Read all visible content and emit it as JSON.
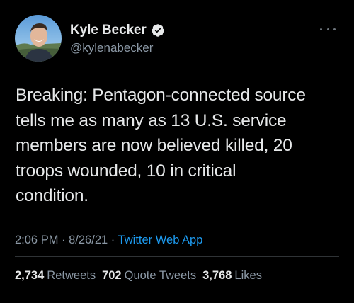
{
  "user": {
    "display_name": "Kyle Becker",
    "handle": "@kylenabecker",
    "verified_icon": "verified-badge-icon",
    "avatar_icon": "profile-photo"
  },
  "tweet": {
    "text": "Breaking: Pentagon-connected source\ntells me as many as 13 U.S. service\nmembers are now believed killed, 20\ntroops wounded, 10 in critical\ncondition."
  },
  "meta": {
    "time": "2:06 PM",
    "separator": " · ",
    "date": "8/26/21",
    "source": "Twitter Web App"
  },
  "stats": {
    "retweets_count": "2,734",
    "retweets_label": "Retweets",
    "quote_tweets_count": "702",
    "quote_tweets_label": "Quote Tweets",
    "likes_count": "3,768",
    "likes_label": "Likes"
  },
  "colors": {
    "background": "#000000",
    "text_primary": "#e7e9ea",
    "text_secondary": "#8b98a5",
    "link": "#1d9bf0",
    "verified": "#1d9bf0",
    "divider": "#2f3336"
  },
  "more_icon": "more-horizontal-icon"
}
